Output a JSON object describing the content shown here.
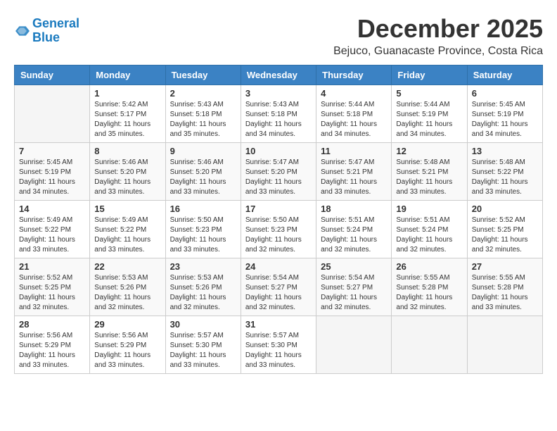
{
  "logo": {
    "line1": "General",
    "line2": "Blue"
  },
  "title": "December 2025",
  "subtitle": "Bejuco, Guanacaste Province, Costa Rica",
  "days_of_week": [
    "Sunday",
    "Monday",
    "Tuesday",
    "Wednesday",
    "Thursday",
    "Friday",
    "Saturday"
  ],
  "weeks": [
    [
      {
        "day": "",
        "info": ""
      },
      {
        "day": "1",
        "info": "Sunrise: 5:42 AM\nSunset: 5:17 PM\nDaylight: 11 hours\nand 35 minutes."
      },
      {
        "day": "2",
        "info": "Sunrise: 5:43 AM\nSunset: 5:18 PM\nDaylight: 11 hours\nand 35 minutes."
      },
      {
        "day": "3",
        "info": "Sunrise: 5:43 AM\nSunset: 5:18 PM\nDaylight: 11 hours\nand 34 minutes."
      },
      {
        "day": "4",
        "info": "Sunrise: 5:44 AM\nSunset: 5:18 PM\nDaylight: 11 hours\nand 34 minutes."
      },
      {
        "day": "5",
        "info": "Sunrise: 5:44 AM\nSunset: 5:19 PM\nDaylight: 11 hours\nand 34 minutes."
      },
      {
        "day": "6",
        "info": "Sunrise: 5:45 AM\nSunset: 5:19 PM\nDaylight: 11 hours\nand 34 minutes."
      }
    ],
    [
      {
        "day": "7",
        "info": "Sunrise: 5:45 AM\nSunset: 5:19 PM\nDaylight: 11 hours\nand 34 minutes."
      },
      {
        "day": "8",
        "info": "Sunrise: 5:46 AM\nSunset: 5:20 PM\nDaylight: 11 hours\nand 33 minutes."
      },
      {
        "day": "9",
        "info": "Sunrise: 5:46 AM\nSunset: 5:20 PM\nDaylight: 11 hours\nand 33 minutes."
      },
      {
        "day": "10",
        "info": "Sunrise: 5:47 AM\nSunset: 5:20 PM\nDaylight: 11 hours\nand 33 minutes."
      },
      {
        "day": "11",
        "info": "Sunrise: 5:47 AM\nSunset: 5:21 PM\nDaylight: 11 hours\nand 33 minutes."
      },
      {
        "day": "12",
        "info": "Sunrise: 5:48 AM\nSunset: 5:21 PM\nDaylight: 11 hours\nand 33 minutes."
      },
      {
        "day": "13",
        "info": "Sunrise: 5:48 AM\nSunset: 5:22 PM\nDaylight: 11 hours\nand 33 minutes."
      }
    ],
    [
      {
        "day": "14",
        "info": "Sunrise: 5:49 AM\nSunset: 5:22 PM\nDaylight: 11 hours\nand 33 minutes."
      },
      {
        "day": "15",
        "info": "Sunrise: 5:49 AM\nSunset: 5:22 PM\nDaylight: 11 hours\nand 33 minutes."
      },
      {
        "day": "16",
        "info": "Sunrise: 5:50 AM\nSunset: 5:23 PM\nDaylight: 11 hours\nand 33 minutes."
      },
      {
        "day": "17",
        "info": "Sunrise: 5:50 AM\nSunset: 5:23 PM\nDaylight: 11 hours\nand 32 minutes."
      },
      {
        "day": "18",
        "info": "Sunrise: 5:51 AM\nSunset: 5:24 PM\nDaylight: 11 hours\nand 32 minutes."
      },
      {
        "day": "19",
        "info": "Sunrise: 5:51 AM\nSunset: 5:24 PM\nDaylight: 11 hours\nand 32 minutes."
      },
      {
        "day": "20",
        "info": "Sunrise: 5:52 AM\nSunset: 5:25 PM\nDaylight: 11 hours\nand 32 minutes."
      }
    ],
    [
      {
        "day": "21",
        "info": "Sunrise: 5:52 AM\nSunset: 5:25 PM\nDaylight: 11 hours\nand 32 minutes."
      },
      {
        "day": "22",
        "info": "Sunrise: 5:53 AM\nSunset: 5:26 PM\nDaylight: 11 hours\nand 32 minutes."
      },
      {
        "day": "23",
        "info": "Sunrise: 5:53 AM\nSunset: 5:26 PM\nDaylight: 11 hours\nand 32 minutes."
      },
      {
        "day": "24",
        "info": "Sunrise: 5:54 AM\nSunset: 5:27 PM\nDaylight: 11 hours\nand 32 minutes."
      },
      {
        "day": "25",
        "info": "Sunrise: 5:54 AM\nSunset: 5:27 PM\nDaylight: 11 hours\nand 32 minutes."
      },
      {
        "day": "26",
        "info": "Sunrise: 5:55 AM\nSunset: 5:28 PM\nDaylight: 11 hours\nand 32 minutes."
      },
      {
        "day": "27",
        "info": "Sunrise: 5:55 AM\nSunset: 5:28 PM\nDaylight: 11 hours\nand 33 minutes."
      }
    ],
    [
      {
        "day": "28",
        "info": "Sunrise: 5:56 AM\nSunset: 5:29 PM\nDaylight: 11 hours\nand 33 minutes."
      },
      {
        "day": "29",
        "info": "Sunrise: 5:56 AM\nSunset: 5:29 PM\nDaylight: 11 hours\nand 33 minutes."
      },
      {
        "day": "30",
        "info": "Sunrise: 5:57 AM\nSunset: 5:30 PM\nDaylight: 11 hours\nand 33 minutes."
      },
      {
        "day": "31",
        "info": "Sunrise: 5:57 AM\nSunset: 5:30 PM\nDaylight: 11 hours\nand 33 minutes."
      },
      {
        "day": "",
        "info": ""
      },
      {
        "day": "",
        "info": ""
      },
      {
        "day": "",
        "info": ""
      }
    ]
  ]
}
